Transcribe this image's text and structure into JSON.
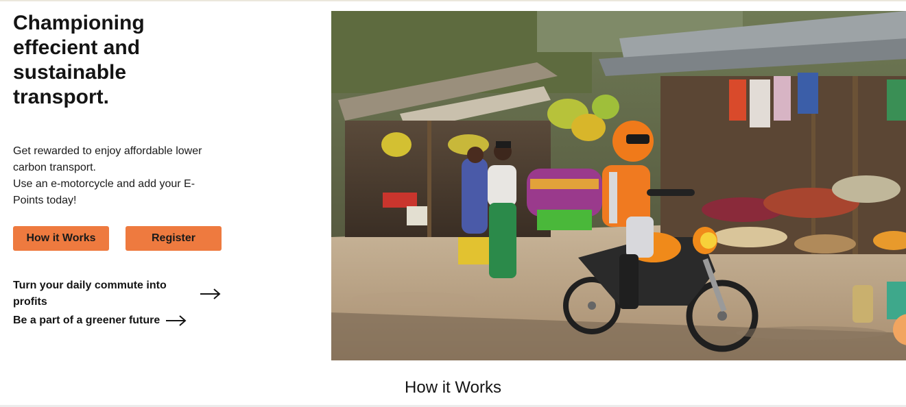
{
  "hero": {
    "title": "Championing effecient and sustainable transport.",
    "description_line_1": "Get rewarded to enjoy affordable lower carbon transport.",
    "description_line_2": "Use an e-motorcycle and add your E-Points today!",
    "buttons": {
      "how_it_works": "How it Works",
      "register": "Register"
    },
    "links": {
      "commute": "Turn your daily commute into profits",
      "greener": "Be a part of a greener future"
    },
    "icons": [
      "arrow-right-icon",
      "chat-icon"
    ],
    "image_description": "Rider in orange safety vest and helmet on an e-motorcycle passing a roadside market with fruit stalls"
  },
  "section": {
    "title": "How it Works"
  },
  "colors": {
    "accent": "#ee7a3f",
    "text": "#141414",
    "background": "#ffffff"
  }
}
